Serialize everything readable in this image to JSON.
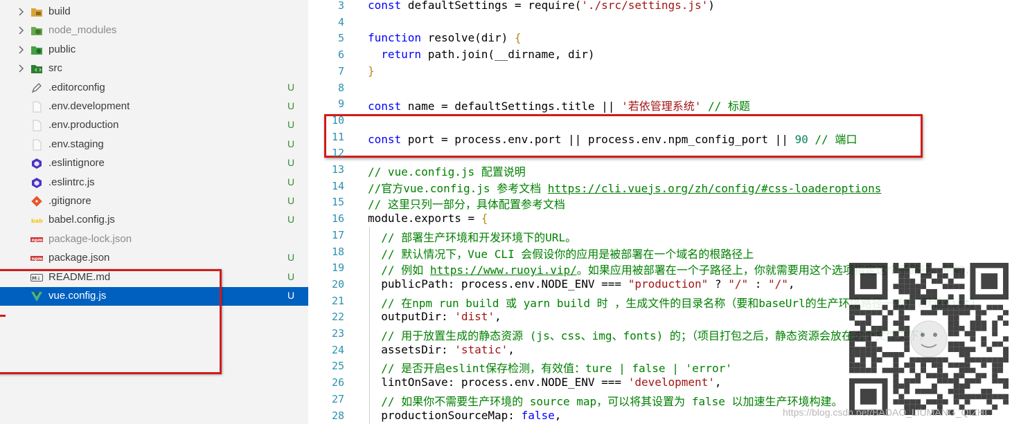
{
  "explorer": {
    "items": [
      {
        "label": "build",
        "type": "folder",
        "icon": "build-folder-icon",
        "status": ""
      },
      {
        "label": "node_modules",
        "type": "folder",
        "icon": "node-modules-folder-icon",
        "status": "",
        "dim": true
      },
      {
        "label": "public",
        "type": "folder",
        "icon": "public-folder-icon",
        "status": ""
      },
      {
        "label": "src",
        "type": "folder",
        "icon": "src-folder-icon",
        "status": ""
      },
      {
        "label": ".editorconfig",
        "type": "file",
        "icon": "editorconfig-icon",
        "status": "U"
      },
      {
        "label": ".env.development",
        "type": "file",
        "icon": "file-icon",
        "status": "U"
      },
      {
        "label": ".env.production",
        "type": "file",
        "icon": "file-icon",
        "status": "U"
      },
      {
        "label": ".env.staging",
        "type": "file",
        "icon": "file-icon",
        "status": "U"
      },
      {
        "label": ".eslintignore",
        "type": "file",
        "icon": "eslint-icon",
        "status": "U"
      },
      {
        "label": ".eslintrc.js",
        "type": "file",
        "icon": "eslint-icon",
        "status": "U"
      },
      {
        "label": ".gitignore",
        "type": "file",
        "icon": "git-icon",
        "status": "U"
      },
      {
        "label": "babel.config.js",
        "type": "file",
        "icon": "babel-icon",
        "status": "U"
      },
      {
        "label": "package-lock.json",
        "type": "file",
        "icon": "npm-icon",
        "status": "",
        "dim": true
      },
      {
        "label": "package.json",
        "type": "file",
        "icon": "npm-icon",
        "status": "U"
      },
      {
        "label": "README.md",
        "type": "file",
        "icon": "markdown-icon",
        "status": "U"
      },
      {
        "label": "vue.config.js",
        "type": "file",
        "icon": "vue-icon",
        "status": "U",
        "selected": true
      }
    ]
  },
  "editor": {
    "lines": [
      {
        "n": "3",
        "tokens": [
          [
            "kw",
            "const"
          ],
          [
            "p",
            " defaultSettings = require("
          ],
          [
            "str",
            "'./src/settings.js'"
          ],
          [
            "p",
            ")"
          ]
        ]
      },
      {
        "n": "4",
        "tokens": []
      },
      {
        "n": "5",
        "tokens": [
          [
            "kw",
            "function"
          ],
          [
            "p",
            " resolve(dir) "
          ],
          [
            "br",
            "{"
          ]
        ]
      },
      {
        "n": "6",
        "tokens": [
          [
            "p",
            "  "
          ],
          [
            "kw",
            "return"
          ],
          [
            "p",
            " path.join(__dirname, dir)"
          ]
        ]
      },
      {
        "n": "7",
        "tokens": [
          [
            "br",
            "}"
          ]
        ]
      },
      {
        "n": "8",
        "tokens": []
      },
      {
        "n": "9",
        "tokens": [
          [
            "kw",
            "const"
          ],
          [
            "p",
            " name = defaultSettings.title || "
          ],
          [
            "str",
            "'若依管理系统'"
          ],
          [
            "cmt",
            " // 标题"
          ]
        ]
      },
      {
        "n": "10",
        "tokens": []
      },
      {
        "n": "11",
        "tokens": [
          [
            "kw",
            "const"
          ],
          [
            "p",
            " port = process.env.port || process.env.npm_config_port || "
          ],
          [
            "num",
            "90"
          ],
          [
            "cmt",
            " // 端口"
          ]
        ]
      },
      {
        "n": "12",
        "tokens": []
      },
      {
        "n": "13",
        "tokens": [
          [
            "cmt",
            "// vue.config.js 配置说明"
          ]
        ]
      },
      {
        "n": "14",
        "tokens": [
          [
            "cmt",
            "//官方vue.config.js 参考文档 "
          ],
          [
            "lnk",
            "https://cli.vuejs.org/zh/config/#css-loaderoptions"
          ]
        ]
      },
      {
        "n": "15",
        "tokens": [
          [
            "cmt",
            "// 这里只列一部分，具体配置参考文档"
          ]
        ]
      },
      {
        "n": "16",
        "tokens": [
          [
            "p",
            "module.exports = "
          ],
          [
            "br",
            "{"
          ]
        ]
      },
      {
        "n": "17",
        "tokens": [
          [
            "p",
            "  "
          ],
          [
            "cmt",
            "// 部署生产环境和开发环境下的URL。"
          ]
        ]
      },
      {
        "n": "18",
        "tokens": [
          [
            "p",
            "  "
          ],
          [
            "cmt",
            "// 默认情况下，Vue CLI 会假设你的应用是被部署在一个域名的根路径上"
          ]
        ]
      },
      {
        "n": "19",
        "tokens": [
          [
            "p",
            "  "
          ],
          [
            "cmt",
            "// 例如 "
          ],
          [
            "lnk",
            "https://www.ruoyi.vip/"
          ],
          [
            "cmt",
            "。如果应用被部署在一个子路径上，你就需要用这个选项指定这个子路径。例如，"
          ]
        ]
      },
      {
        "n": "20",
        "tokens": [
          [
            "p",
            "  publicPath: process.env.NODE_ENV === "
          ],
          [
            "str",
            "\"production\""
          ],
          [
            "p",
            " ? "
          ],
          [
            "str",
            "\"/\""
          ],
          [
            "p",
            " : "
          ],
          [
            "str",
            "\"/\""
          ],
          [
            "p",
            ","
          ]
        ]
      },
      {
        "n": "21",
        "tokens": [
          [
            "p",
            "  "
          ],
          [
            "cmt",
            "// 在npm run build 或 yarn build 时 ，生成文件的目录名称（要和baseUrl的生产环境路径一致）（默认dist）"
          ]
        ]
      },
      {
        "n": "22",
        "tokens": [
          [
            "p",
            "  outputDir: "
          ],
          [
            "str",
            "'dist'"
          ],
          [
            "p",
            ","
          ]
        ]
      },
      {
        "n": "23",
        "tokens": [
          [
            "p",
            "  "
          ],
          [
            "cmt",
            "// 用于放置生成的静态资源 (js、css、img、fonts) 的；（项目打包之后，静态资源会放在这个文件夹下）"
          ]
        ]
      },
      {
        "n": "24",
        "tokens": [
          [
            "p",
            "  assetsDir: "
          ],
          [
            "str",
            "'static'"
          ],
          [
            "p",
            ","
          ]
        ]
      },
      {
        "n": "25",
        "tokens": [
          [
            "p",
            "  "
          ],
          [
            "cmt",
            "// 是否开启eslint保存检测，有效值：ture | false | 'error'"
          ]
        ]
      },
      {
        "n": "26",
        "tokens": [
          [
            "p",
            "  lintOnSave: process.env.NODE_ENV === "
          ],
          [
            "str",
            "'development'"
          ],
          [
            "p",
            ","
          ]
        ]
      },
      {
        "n": "27",
        "tokens": [
          [
            "p",
            "  "
          ],
          [
            "cmt",
            "// 如果你不需要生产环境的 source map，可以将其设置为 false 以加速生产环境构建。"
          ]
        ]
      },
      {
        "n": "28",
        "tokens": [
          [
            "p",
            "  productionSourceMap: "
          ],
          [
            "kw",
            "false"
          ],
          [
            "p",
            ","
          ]
        ]
      }
    ]
  },
  "watermark": "https://blog.csdn.net/BADAO_LIUMANG_QIZHI",
  "colors": {
    "selection": "#0060c0",
    "highlight_box": "#d11a1a",
    "git_untracked": "#3b8a3b",
    "keyword": "#0000ff",
    "string": "#a31515",
    "comment": "#008000",
    "number": "#098658",
    "line_number": "#2b91af"
  }
}
